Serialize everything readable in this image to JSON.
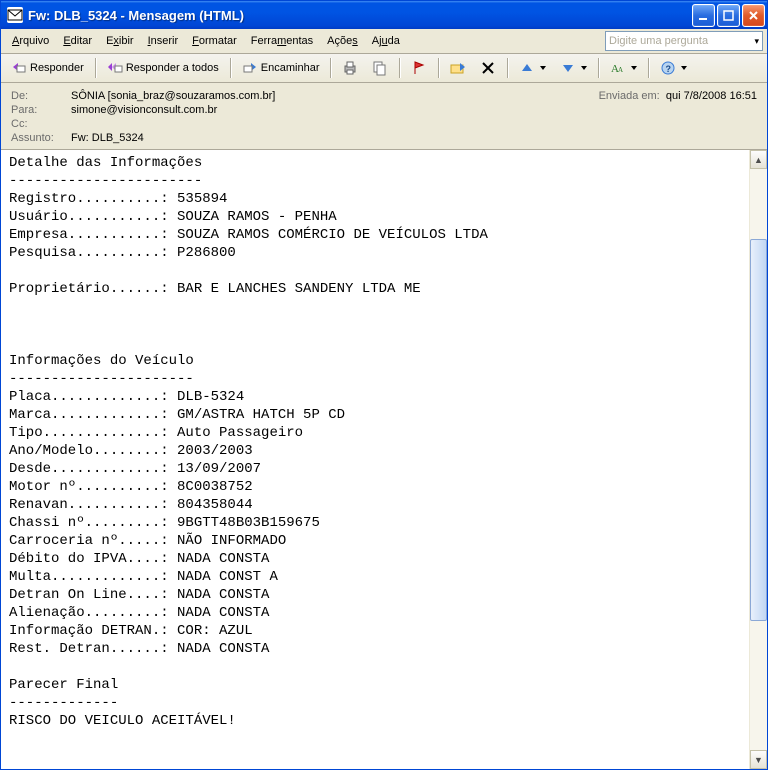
{
  "title": "Fw: DLB_5324 - Mensagem (HTML)",
  "menu": {
    "arquivo": "Arquivo",
    "editar": "Editar",
    "exibir": "Exibir",
    "inserir": "Inserir",
    "formatar": "Formatar",
    "ferramentas": "Ferramentas",
    "acoes": "Ações",
    "ajuda": "Ajuda",
    "ask_placeholder": "Digite uma pergunta"
  },
  "toolbar": {
    "responder": "Responder",
    "responder_todos": "Responder a todos",
    "encaminhar": "Encaminhar"
  },
  "headers": {
    "de_label": "De:",
    "de_value": "SÔNIA [sonia_braz@souzaramos.com.br]",
    "sent_label": "Enviada em:",
    "sent_value": "qui 7/8/2008 16:51",
    "para_label": "Para:",
    "para_value": "simone@visionconsult.com.br",
    "cc_label": "Cc:",
    "cc_value": "",
    "assunto_label": "Assunto:",
    "assunto_value": "Fw: DLB_5324"
  },
  "body": "Detalhe das Informações\n-----------------------\nRegistro..........: 535894\nUsuário...........: SOUZA RAMOS - PENHA\nEmpresa...........: SOUZA RAMOS COMÉRCIO DE VEÍCULOS LTDA\nPesquisa..........: P286800\n\nProprietário......: BAR E LANCHES SANDENY LTDA ME\n\n\n\nInformações do Veículo\n----------------------\nPlaca.............: DLB-5324\nMarca.............: GM/ASTRA HATCH 5P CD\nTipo..............: Auto Passageiro\nAno/Modelo........: 2003/2003\nDesde.............: 13/09/2007\nMotor nº..........: 8C0038752\nRenavan...........: 804358044\nChassi nº.........: 9BGTT48B03B159675\nCarroceria nº.....: NÃO INFORMADO\nDébito do IPVA....: NADA CONSTA\nMulta.............: NADA CONST A\nDetran On Line....: NADA CONSTA\nAlienação.........: NADA CONSTA\nInformação DETRAN.: COR: AZUL\nRest. Detran......: NADA CONSTA\n\nParecer Final\n-------------\nRISCO DO VEICULO ACEITÁVEL!\n"
}
